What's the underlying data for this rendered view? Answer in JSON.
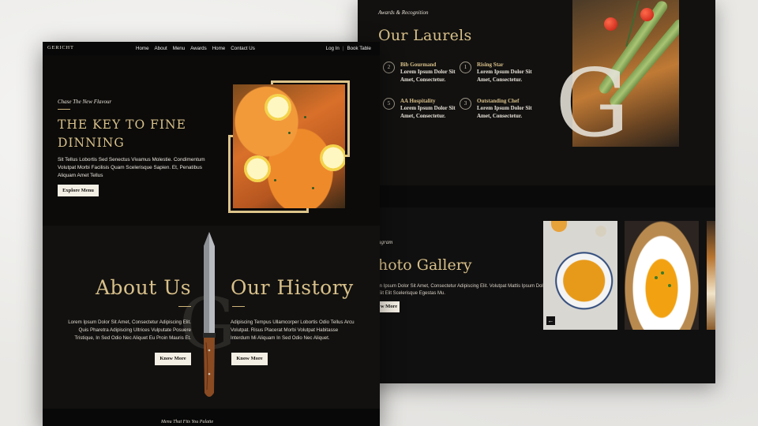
{
  "back_page": {
    "laurels": {
      "eyebrow": "Awards & Recognition",
      "title": "Our Laurels",
      "awards": [
        {
          "num": "2",
          "title": "Bib Gourmand",
          "desc": "Lorem Ipsum Dolor Sit Amet, Consectetur."
        },
        {
          "num": "1",
          "title": "Rising Star",
          "desc": "Lorem Ipsum Dolor Sit Amet, Consectetur."
        },
        {
          "num": "5",
          "title": "AA Hospitality",
          "desc": "Lorem Ipsum Dolor Sit Amet, Consectetur."
        },
        {
          "num": "3",
          "title": "Outstanding Chef",
          "desc": "Lorem Ipsum Dolor Sit Amet, Consectetur."
        }
      ],
      "watermark": "G"
    },
    "gallery": {
      "eyebrow": "agram",
      "title": "hoto Gallery",
      "text": "m Ipsum Dolor Sit Amet, Consectetur Adipiscing Elit. Volutpat Mattis Ipsum Dolor Sit Elit Scelerisque Egestas Mu.",
      "button": "w More",
      "arrow": "←"
    }
  },
  "front_page": {
    "nav": {
      "logo": "GERICHT",
      "links": [
        "Home",
        "About",
        "Menu",
        "Awards",
        "Home",
        "Contact Us"
      ],
      "login": "Log In",
      "separator": "|",
      "book": "Book Table"
    },
    "hero": {
      "eyebrow": "Chase The New Flavour",
      "title": "THE KEY TO FINE DINNING",
      "text": "Sit Tellus Lobortis Sed Senectus Vivamus Molestie. Condimentum Volutpat Morbi Facilisis Quam Scelerisque Sapien. Et, Penatibus Aliquam Amet Tellus",
      "button": "Explore Menu"
    },
    "about": {
      "about_title": "About Us",
      "about_text": "Lorem Ipsum Dolor Sit Amet, Consectetur Adipiscing Elit. Quis Pharetra Adipiscing Ultrices Vulputate Posuere Tristique, In Sed Odio Nec Aliquet Eu Proin Mauris Et.",
      "about_button": "Know More",
      "history_title": "Our History",
      "history_text": "Adipiscing Tempus Ullamcorper Lobortis Odio Tellus Arcu Volutpat. Risus Placerat Morbi Volutpat Habitasse Interdum Mi Aliquam In Sed Odio Nec Aliquet.",
      "history_button": "Know More",
      "watermark": "G"
    },
    "footer_teaser": "Menu That Fits You Palatte"
  },
  "colors": {
    "gold": "#d8c089",
    "page_bg": "#0e0d0c",
    "button_bg": "#f4efe4"
  }
}
